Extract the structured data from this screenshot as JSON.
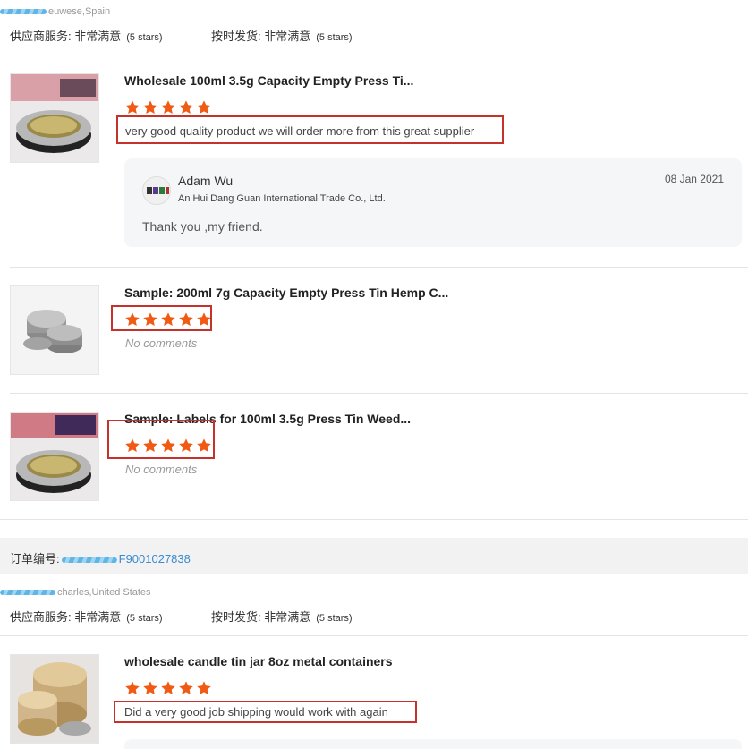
{
  "review1": {
    "buyer": "euwese,Spain",
    "rating_service_label": "供应商服务: 非常满意",
    "rating_service_stars": "(5 stars)",
    "rating_shipping_label": "按时发货: 非常满意",
    "rating_shipping_stars": "(5 stars)",
    "items": [
      {
        "title": "Wholesale 100ml 3.5g Capacity Empty Press Ti...",
        "rating": 5,
        "comment": "very good quality product we will order more from this great supplier",
        "reply": {
          "name": "Adam Wu",
          "company": "An Hui Dang Guan International Trade Co., Ltd.",
          "date": "08 Jan 2021",
          "text": "Thank you ,my friend."
        }
      },
      {
        "title": "Sample: 200ml 7g Capacity Empty Press Tin Hemp C...",
        "rating": 5,
        "comment": "No comments"
      },
      {
        "title": "Sample: Labels for 100ml 3.5g Press Tin Weed...",
        "rating": 5,
        "comment": "No comments"
      }
    ]
  },
  "order": {
    "label": "订单编号:",
    "number_visible": "F9001027838"
  },
  "review2": {
    "buyer": "charles,United States",
    "rating_service_label": "供应商服务: 非常满意",
    "rating_service_stars": "(5 stars)",
    "rating_shipping_label": "按时发货: 非常满意",
    "rating_shipping_stars": "(5 stars)",
    "items": [
      {
        "title": "wholesale candle tin jar 8oz metal containers",
        "rating": 5,
        "comment": "Did a very good job shipping would work with again"
      }
    ]
  },
  "colors": {
    "star": "#f05a14",
    "highlight_box": "#c5322b",
    "link": "#3b8ad0"
  },
  "icons": {
    "star": "star-icon",
    "avatar": "avatar"
  }
}
